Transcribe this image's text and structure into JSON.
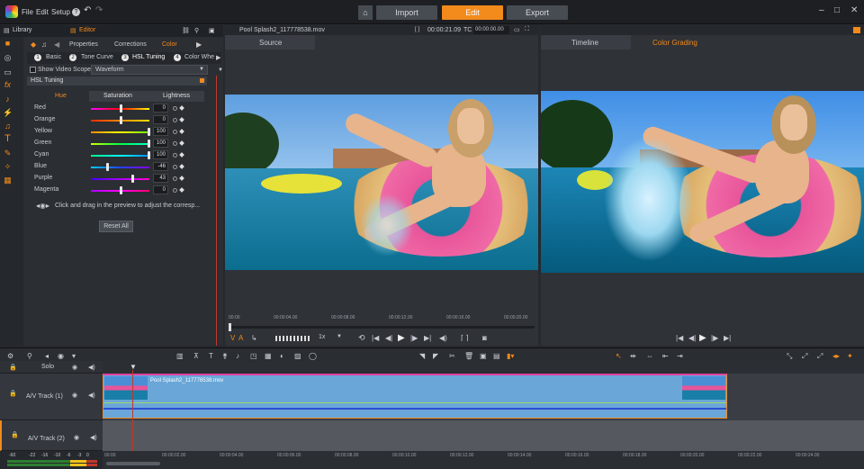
{
  "app": {
    "menu": [
      "File",
      "Edit",
      "Setup"
    ],
    "top_buttons": [
      {
        "label": "Import",
        "active": false
      },
      {
        "label": "Edit",
        "active": true
      },
      {
        "label": "Export",
        "active": false
      }
    ]
  },
  "library": {
    "library_tab": "Library",
    "editor_tab": "Editor",
    "tabs": [
      "Properties",
      "Corrections",
      "Color"
    ],
    "active_tab": "Color",
    "subtabs": [
      "Basic",
      "Tone Curve",
      "HSL Tuning",
      "Color Whe"
    ],
    "active_subtab": "HSL Tuning",
    "video_scope_label": "Show Video Scope",
    "video_scope_value": "Waveform",
    "section_title": "HSL Tuning",
    "hsl_tabs": [
      "Hue",
      "Saturation",
      "Lightness"
    ],
    "active_hsl_tab": "Hue",
    "sliders": [
      {
        "label": "Red",
        "value": "0",
        "pos": 0.5
      },
      {
        "label": "Orange",
        "value": "0",
        "pos": 0.5
      },
      {
        "label": "Yellow",
        "value": "100",
        "pos": 1.0
      },
      {
        "label": "Green",
        "value": "100",
        "pos": 1.0
      },
      {
        "label": "Cyan",
        "value": "100",
        "pos": 1.0
      },
      {
        "label": "Blue",
        "value": "-46",
        "pos": 0.27
      },
      {
        "label": "Purple",
        "value": "43",
        "pos": 0.72
      },
      {
        "label": "Magenta",
        "value": "0",
        "pos": 0.5
      }
    ],
    "hint": "Click and drag in the preview to adjust the corresp...",
    "reset_button": "Reset All"
  },
  "source": {
    "filename": "Pool Splash2_117778538.mov",
    "timecode": "00:00:21.09",
    "tc_label": "TC",
    "tc_value": "00:00:00.00",
    "tab_label": "Source",
    "ruler": [
      "00:00",
      "00:00:04.00",
      "00:00:08.00",
      "00:00:12.00",
      "00:00:16.00",
      "00:00:20.00"
    ],
    "speed": "1x"
  },
  "preview_tabs": [
    "Timeline",
    "Color Grading"
  ],
  "active_preview_tab": "Color Grading",
  "timeline": {
    "solo_label": "Solo",
    "tracks": [
      {
        "label": "A/V Track (1)"
      },
      {
        "label": "A/V Track (2)"
      }
    ],
    "clip_name": "Pool Splash2_117778538.mov",
    "ruler": [
      "00:00",
      "00:00:02.00",
      "00:00:04.00",
      "00:00:06.00",
      "00:00:08.00",
      "00:00:10.00",
      "00:00:12.00",
      "00:00:14.00",
      "00:00:16.00",
      "00:00:18.00",
      "00:00:20.00",
      "00:00:22.00",
      "00:00:24.00"
    ],
    "meter_ticks": [
      "-60",
      "-22",
      "-16",
      "-10",
      "-6",
      "-3",
      "0"
    ]
  },
  "colors": {
    "accent": "#f28a1c",
    "clip": "#6aa7d8",
    "clip_border": "#f28a1c"
  }
}
